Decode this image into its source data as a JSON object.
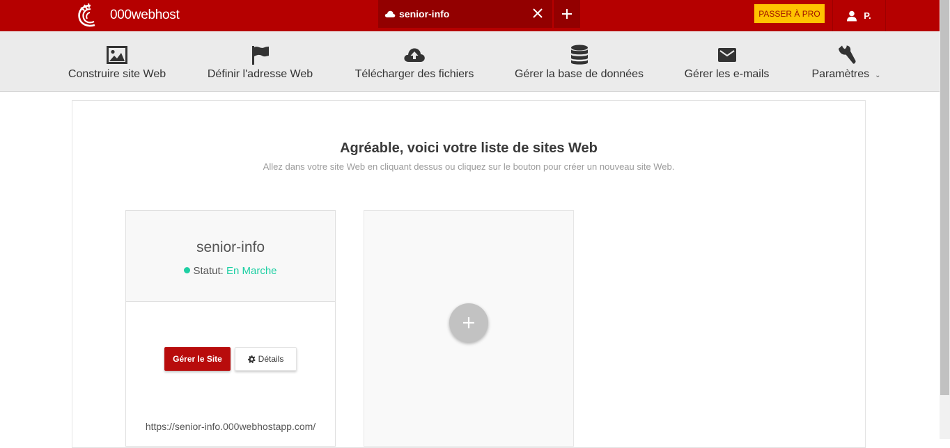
{
  "topbar": {
    "logo_text": "000webhost",
    "site_tab": {
      "label": "senior-info",
      "icon": "cloud-icon"
    },
    "pro_button": "PASSER À PRO",
    "user_label": "P."
  },
  "nav": {
    "items": [
      {
        "label": "Construire site Web",
        "icon": "image-icon"
      },
      {
        "label": "Définir l'adresse Web",
        "icon": "flag-icon"
      },
      {
        "label": "Télécharger des fichiers",
        "icon": "cloud-upload-icon"
      },
      {
        "label": "Gérer la base de données",
        "icon": "database-icon"
      },
      {
        "label": "Gérer les e-mails",
        "icon": "envelope-icon"
      },
      {
        "label": "Paramètres",
        "icon": "wrench-icon"
      }
    ]
  },
  "main": {
    "heading": "Agréable, voici votre liste de sites Web",
    "subheading": "Allez dans votre site Web en cliquant dessus ou cliquez sur le bouton pour créer un nouveau site Web."
  },
  "site": {
    "name": "senior-info",
    "status_label": "Statut:",
    "status_value": "En Marche",
    "manage_button": "Gérer le Site",
    "details_button": "Détails",
    "url": "https://senior-info.000webhostapp.com/"
  },
  "colors": {
    "brand_red": "#b50000",
    "pro_yellow": "#ffc300",
    "status_green": "#1ecfa3"
  }
}
